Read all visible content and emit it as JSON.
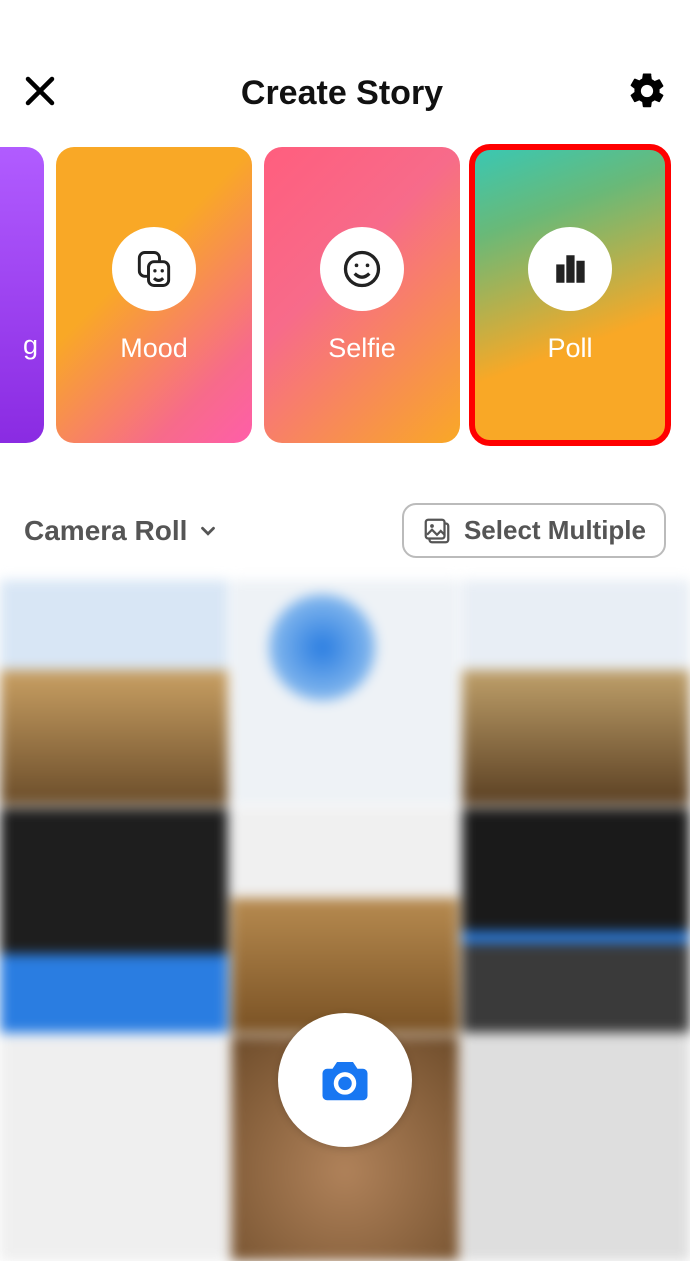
{
  "header": {
    "title": "Create Story"
  },
  "cards": {
    "partial_left_label": "g",
    "mood": "Mood",
    "selfie": "Selfie",
    "poll": "Poll"
  },
  "source": {
    "label": "Camera Roll",
    "select_multiple": "Select Multiple"
  },
  "highlighted_card": "poll"
}
